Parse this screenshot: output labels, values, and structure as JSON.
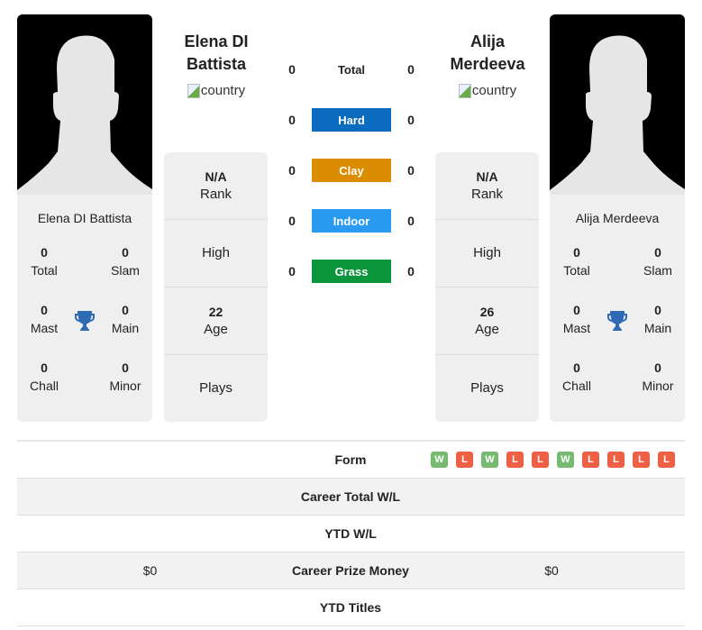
{
  "players": [
    {
      "name": "Elena DI Battista",
      "title_line1": "Elena DI",
      "title_line2": "Battista",
      "country_alt": "country",
      "stats": {
        "total": {
          "value": "0",
          "label": "Total"
        },
        "slam": {
          "value": "0",
          "label": "Slam"
        },
        "mast": {
          "value": "0",
          "label": "Mast"
        },
        "main": {
          "value": "0",
          "label": "Main"
        },
        "chall": {
          "value": "0",
          "label": "Chall"
        },
        "minor": {
          "value": "0",
          "label": "Minor"
        }
      },
      "info": {
        "rank_value": "N/A",
        "rank_label": "Rank",
        "high_label": "High",
        "age_value": "22",
        "age_label": "Age",
        "plays_label": "Plays"
      },
      "prize_money": "$0"
    },
    {
      "name": "Alija Merdeeva",
      "title_line1": "Alija",
      "title_line2": "Merdeeva",
      "country_alt": "country",
      "stats": {
        "total": {
          "value": "0",
          "label": "Total"
        },
        "slam": {
          "value": "0",
          "label": "Slam"
        },
        "mast": {
          "value": "0",
          "label": "Mast"
        },
        "main": {
          "value": "0",
          "label": "Main"
        },
        "chall": {
          "value": "0",
          "label": "Chall"
        },
        "minor": {
          "value": "0",
          "label": "Minor"
        }
      },
      "info": {
        "rank_value": "N/A",
        "rank_label": "Rank",
        "high_label": "High",
        "age_value": "26",
        "age_label": "Age",
        "plays_label": "Plays"
      },
      "prize_money": "$0"
    }
  ],
  "h2h": [
    {
      "label": "Total",
      "left": "0",
      "right": "0",
      "color": ""
    },
    {
      "label": "Hard",
      "left": "0",
      "right": "0",
      "color": "#0a6bbf"
    },
    {
      "label": "Clay",
      "left": "0",
      "right": "0",
      "color": "#dc8c00"
    },
    {
      "label": "Indoor",
      "left": "0",
      "right": "0",
      "color": "#2a9af0"
    },
    {
      "label": "Grass",
      "left": "0",
      "right": "0",
      "color": "#0c963c"
    }
  ],
  "form": {
    "label": "Form",
    "results": [
      "W",
      "L",
      "W",
      "L",
      "L",
      "W",
      "L",
      "L",
      "L",
      "L"
    ],
    "colors": {
      "W": "#77bb72",
      "L": "#ee5f43"
    }
  },
  "table": [
    {
      "label": "Career Total W/L",
      "left": "",
      "right": ""
    },
    {
      "label": "YTD W/L",
      "left": "",
      "right": ""
    },
    {
      "label": "Career Prize Money",
      "left": "$0",
      "right": "$0"
    },
    {
      "label": "YTD Titles",
      "left": "",
      "right": ""
    }
  ],
  "trophy_color": "#2f6ab5"
}
